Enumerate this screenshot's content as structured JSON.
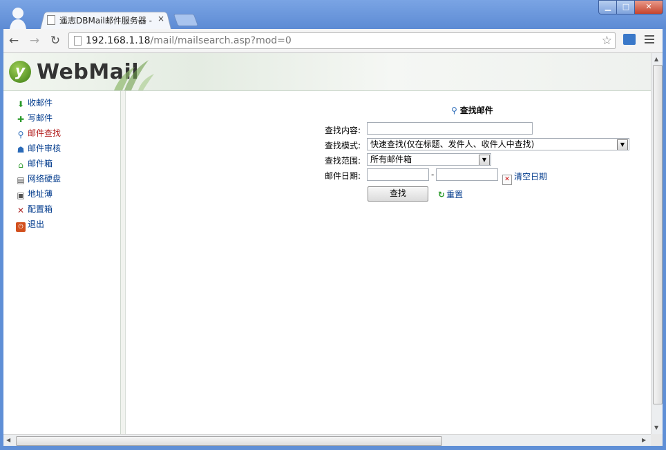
{
  "browser": {
    "tab_title": "遥志DBMail邮件服务器 - \\",
    "tab_close": "×",
    "url_host": "192.168.1.18",
    "url_path": "/mail/mailsearch.asp?mod=0",
    "window_buttons": {
      "minimize": "▁",
      "maximize": "□",
      "close": "✕"
    }
  },
  "app": {
    "logo_text": "WebMail"
  },
  "sidebar": {
    "items": [
      {
        "label": "收邮件",
        "icon": "inbox-download-icon",
        "active": false
      },
      {
        "label": "写邮件",
        "icon": "compose-icon",
        "active": false
      },
      {
        "label": "邮件查找",
        "icon": "magnifier-icon",
        "active": true
      },
      {
        "label": "邮件审核",
        "icon": "user-audit-icon",
        "active": false
      },
      {
        "label": "邮件箱",
        "icon": "house-icon",
        "active": false
      },
      {
        "label": "网络硬盘",
        "icon": "disk-icon",
        "active": false
      },
      {
        "label": "地址薄",
        "icon": "address-book-icon",
        "active": false
      },
      {
        "label": "配置箱",
        "icon": "tools-icon",
        "active": false
      },
      {
        "label": "退出",
        "icon": "exit-icon",
        "active": false
      }
    ]
  },
  "search": {
    "title": "查找邮件",
    "content_label": "查找内容:",
    "content_value": "",
    "mode_label": "查找模式:",
    "mode_value": "快速查找(仅在标题、发件人、收件人中查找)",
    "scope_label": "查找范围:",
    "scope_value": "所有邮件箱",
    "date_label": "邮件日期:",
    "date_from": "",
    "date_to": "",
    "date_separator": "-",
    "clear_date_label": "清空日期",
    "search_button": "查找",
    "reset_label": "重置"
  },
  "colors": {
    "link": "#003a8c",
    "active_link": "#b01818",
    "window_frame": "#5f8fd6"
  }
}
